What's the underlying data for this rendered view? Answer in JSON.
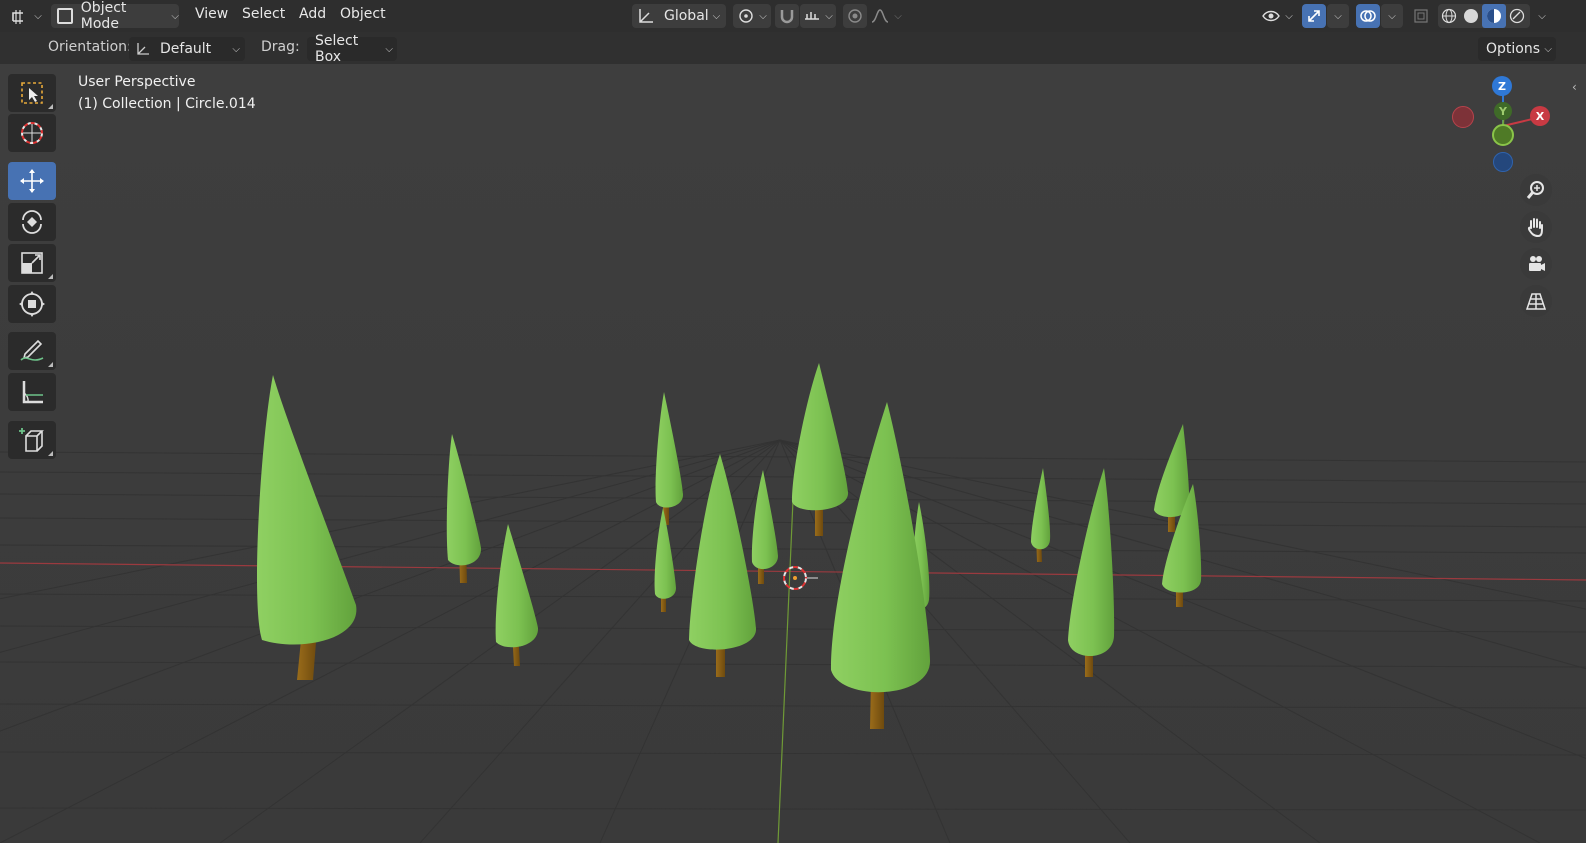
{
  "header": {
    "editor_type_icon": "editor-type-icon",
    "mode": "Object Mode",
    "menus": [
      "View",
      "Select",
      "Add",
      "Object"
    ],
    "transform_orientation": "Global"
  },
  "tool_settings": {
    "orientation_label": "Orientation:",
    "orientation_value": "Default",
    "drag_label": "Drag:",
    "drag_value": "Select Box",
    "options_label": "Options"
  },
  "viewport": {
    "view_name": "User Perspective",
    "object_info": "(1) Collection | Circle.014"
  },
  "gizmo": {
    "z_label": "Z",
    "y_label": "Y",
    "x_label": "X"
  },
  "tools": [
    "select-box",
    "cursor",
    "move",
    "rotate",
    "scale",
    "transform",
    "annotate",
    "measure",
    "add-cube"
  ],
  "nav": [
    "zoom",
    "pan",
    "camera-view",
    "perspective-toggle"
  ],
  "colors": {
    "accent": "#4772b3",
    "tree_foliage": "#7cc151",
    "tree_trunk": "#8a5e14",
    "x_axis": "#c83a43",
    "y_axis": "#6fa23a",
    "z_axis": "#2f78d6"
  }
}
